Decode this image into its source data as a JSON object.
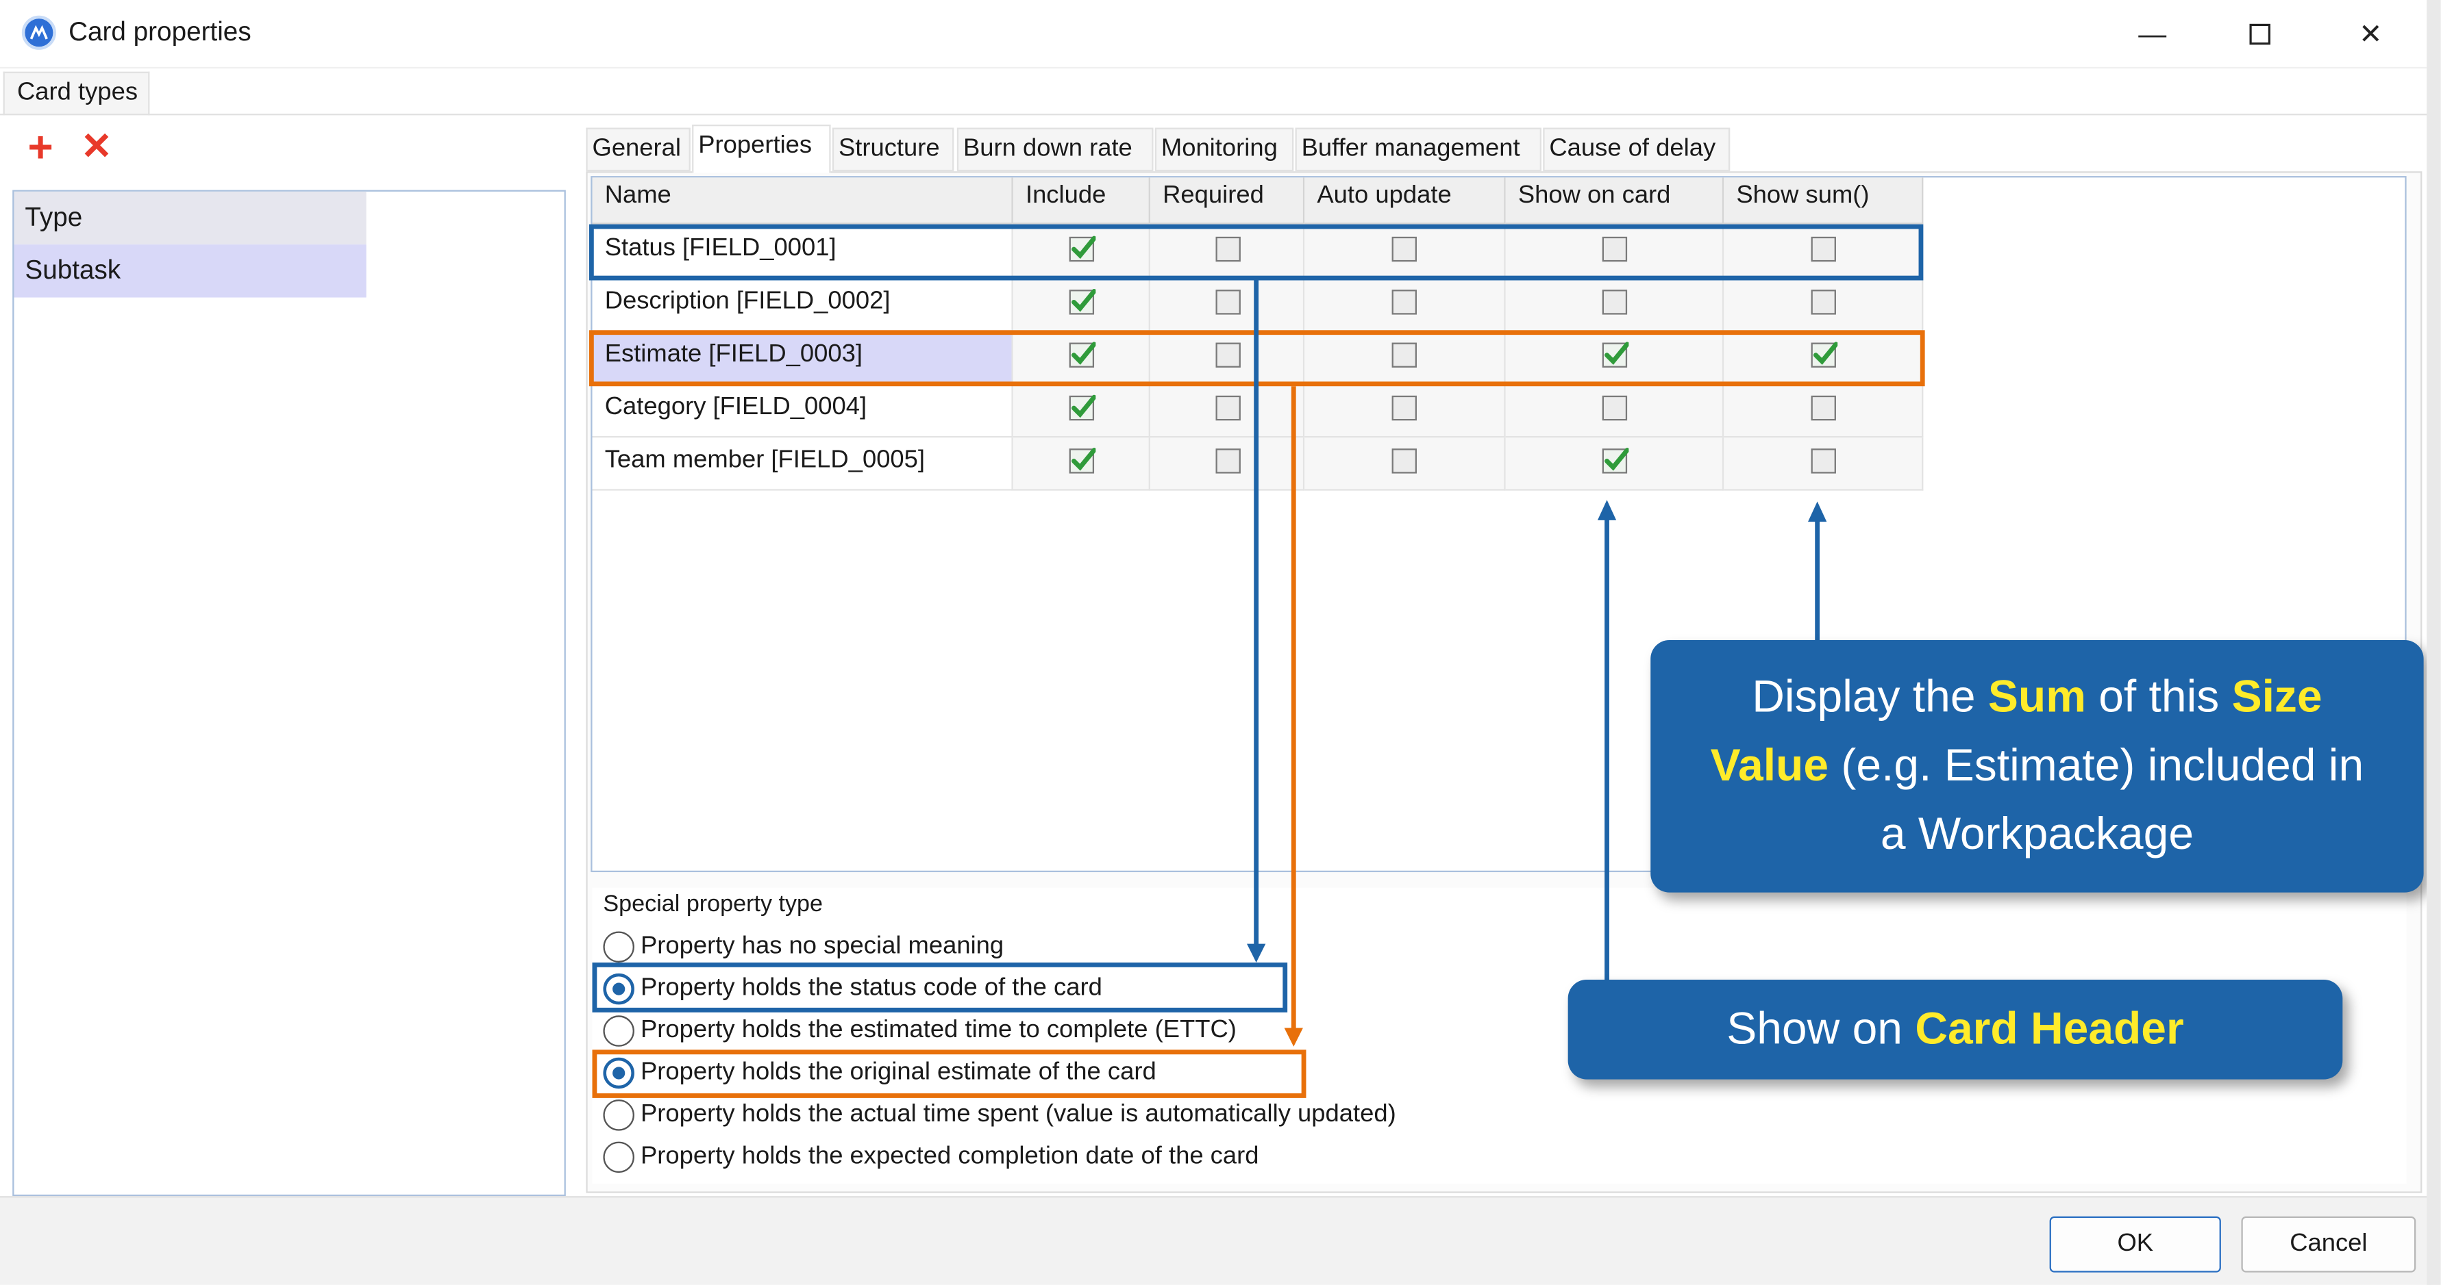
{
  "window": {
    "title": "Card properties",
    "min_glyph": "—",
    "max_glyph": "☐",
    "close_glyph": "✕"
  },
  "left": {
    "tab": "Card types",
    "add_glyph": "+",
    "delete_glyph": "✕",
    "header": "Type",
    "items": [
      "Subtask"
    ]
  },
  "tabs": [
    "General",
    "Properties",
    "Structure",
    "Burn down rate",
    "Monitoring",
    "Buffer management",
    "Cause of delay"
  ],
  "grid": {
    "headers": [
      "Name",
      "Include",
      "Required",
      "Auto update",
      "Show on card",
      "Show sum()"
    ],
    "rows": [
      {
        "name": "Status [FIELD_0001]",
        "include": true,
        "required": false,
        "auto_update": false,
        "show_on_card": false,
        "show_sum": false
      },
      {
        "name": "Description [FIELD_0002]",
        "include": true,
        "required": false,
        "auto_update": false,
        "show_on_card": false,
        "show_sum": false
      },
      {
        "name": "Estimate [FIELD_0003]",
        "include": true,
        "required": false,
        "auto_update": false,
        "show_on_card": true,
        "show_sum": true
      },
      {
        "name": "Category [FIELD_0004]",
        "include": true,
        "required": false,
        "auto_update": false,
        "show_on_card": false,
        "show_sum": false
      },
      {
        "name": "Team member [FIELD_0005]",
        "include": true,
        "required": false,
        "auto_update": false,
        "show_on_card": true,
        "show_sum": false
      }
    ]
  },
  "special": {
    "label": "Special property type",
    "options": [
      {
        "label": "Property has no special meaning",
        "selected": false
      },
      {
        "label": "Property holds the status code of the card",
        "selected": true
      },
      {
        "label": "Property holds the estimated time to complete (ETTC)",
        "selected": false
      },
      {
        "label": "Property holds the original estimate of the card",
        "selected": true
      },
      {
        "label": "Property holds the actual time spent (value is automatically updated)",
        "selected": false
      },
      {
        "label": "Property holds the expected completion date of the card",
        "selected": false
      }
    ]
  },
  "buttons": {
    "ok": "OK",
    "cancel": "Cancel"
  },
  "callouts": {
    "sum": {
      "t1": "Display the ",
      "h1": "Sum",
      "t2": " of this ",
      "h2": "Size",
      "h3": "Value",
      "t3": " (e.g. Estimate) included in a Workpackage"
    },
    "header": {
      "t1": "Show on ",
      "h1": "Card Header"
    }
  },
  "colors": {
    "accent_blue": "#1e64a8",
    "accent_orange": "#e8700a",
    "highlight_yellow": "#ffeb2a",
    "delete_red": "#e8392a"
  },
  "icons": {
    "checked": "green-check-icon",
    "unchecked": "empty-checkbox-icon"
  }
}
